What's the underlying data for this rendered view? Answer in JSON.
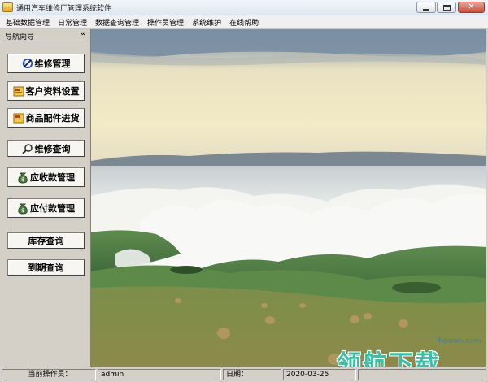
{
  "window": {
    "title": "通用汽车维修厂管理系统软件",
    "min_icon": "minimize-icon",
    "max_icon": "maximize-icon",
    "close_icon": "close-icon"
  },
  "menu": {
    "items": [
      "基础数据管理",
      "日常管理",
      "数据查询管理",
      "操作员管理",
      "系统维护",
      "在线帮助"
    ]
  },
  "sidebar": {
    "title": "导航向导",
    "collapse_label": "«",
    "buttons": [
      {
        "label": "维修管理",
        "icon": "repair-icon"
      },
      {
        "label": "客户资料设置",
        "icon": "folder-icon"
      },
      {
        "label": "商品配件进货",
        "icon": "folder-icon"
      },
      {
        "label": "维修查询",
        "icon": "search-icon"
      },
      {
        "label": "应收款管理",
        "icon": "moneybag-icon"
      },
      {
        "label": "应付款管理",
        "icon": "moneybag-icon"
      },
      {
        "label": "库存查询",
        "icon": ""
      },
      {
        "label": "到期查询",
        "icon": ""
      }
    ]
  },
  "status": {
    "operator_label": "当前操作员：",
    "operator_value": "admin",
    "date_label": "日期：",
    "date_value": "2020-03-25"
  },
  "watermark": {
    "url": "lhdown.com",
    "brand": "领航下载"
  },
  "colors": {
    "sky": "#8ea2b6",
    "glow": "#f1e7bf",
    "grass": "#6f8f4a",
    "accent_watermark": "#3cc0a8"
  }
}
